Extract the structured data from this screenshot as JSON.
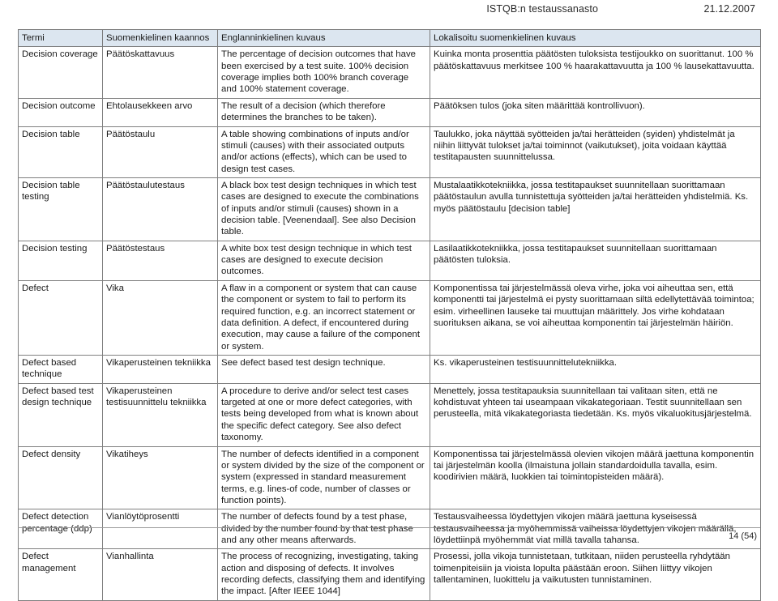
{
  "header": {
    "title": "ISTQB:n testaussanasto",
    "date": "21.12.2007"
  },
  "table": {
    "columns": [
      "Termi",
      "Suomenkielinen kaannos",
      "Englanninkielinen kuvaus",
      "Lokalisoitu suomenkielinen kuvaus"
    ],
    "rows": [
      {
        "term": "Decision coverage",
        "finnish": "Päätöskattavuus",
        "english": "The percentage of decision outcomes that have been exercised by a test suite. 100% decision coverage implies both 100% branch coverage and 100% statement coverage.",
        "localized": "Kuinka monta prosenttia päätösten tuloksista testijoukko on suorittanut. 100 % päätöskattavuus merkitsee 100 % haarakattavuutta ja 100 % lausekattavuutta."
      },
      {
        "term": "Decision outcome",
        "finnish": "Ehtolausekkeen arvo",
        "english": "The result of a decision (which therefore determines the branches to be taken).",
        "localized": "Päätöksen tulos (joka siten määrittää kontrollivuon)."
      },
      {
        "term": "Decision table",
        "finnish": "Päätöstaulu",
        "english": "A table showing combinations of inputs and/or stimuli (causes) with their associated outputs and/or actions (effects), which can be used to design test cases.",
        "localized": "Taulukko, joka näyttää syötteiden ja/tai herätteiden (syiden) yhdistelmät ja niihin liittyvät tulokset ja/tai toiminnot (vaikutukset), joita voidaan käyttää testitapausten suunnittelussa."
      },
      {
        "term": "Decision table testing",
        "finnish": "Päätöstaulutestaus",
        "english": "A black box test design techniques in which test cases are designed to execute the combinations of inputs and/or stimuli (causes) shown in a decision table. [Veenendaal]. See also Decision table.",
        "localized": "Mustalaatikkotekniikka, jossa testitapaukset suunnitellaan suorittamaan päätöstaulun avulla tunnistettuja syötteiden ja/tai herätteiden yhdistelmiä. Ks. myös päätöstaulu [decision table]"
      },
      {
        "term": "Decision testing",
        "finnish": "Päätöstestaus",
        "english": "A white box test design technique in which test cases are designed to execute decision outcomes.",
        "localized": "Lasilaatikkotekniikka, jossa testitapaukset suunnitellaan suorittamaan päätösten tuloksia."
      },
      {
        "term": "Defect",
        "finnish": "Vika",
        "english": "A flaw in a component or system that can cause the component or system to fail to perform its required function, e.g. an incorrect statement or data definition. A defect, if encountered during execution, may cause a failure of the component or system.",
        "localized": "Komponentissa tai järjestelmässä oleva virhe, joka voi aiheuttaa sen, että komponentti tai järjestelmä ei pysty suorittamaan siltä edellytettävää toimintoa; esim. virheellinen lauseke tai muuttujan määrittely. Jos virhe kohdataan suorituksen aikana, se voi aiheuttaa komponentin tai järjestelmän häiriön."
      },
      {
        "term": "Defect based technique",
        "finnish": "Vikaperusteinen tekniikka",
        "english": "See defect based test design technique.",
        "localized": "Ks. vikaperusteinen testisuunnittelutekniikka."
      },
      {
        "term": "Defect based test design technique",
        "finnish": "Vikaperusteinen testisuunnittelu tekniikka",
        "english": "A procedure to derive and/or select test cases targeted at one or more defect categories, with tests being developed from what is known about the specific defect category. See also defect taxonomy.",
        "localized": "Menettely, jossa testitapauksia suunnitellaan tai valitaan siten, että ne kohdistuvat yhteen tai useampaan vikakategoriaan. Testit suunnitellaan sen perusteella, mitä vikakategoriasta tiedetään. Ks. myös vikaluokitusjärjestelmä."
      },
      {
        "term": "Defect density",
        "finnish": "Vikatiheys",
        "english": "The number of defects identified in a component or system divided by the size of the component or system (expressed in standard measurement terms, e.g. lines-of code, number of classes or function points).",
        "localized": "Komponentissa tai järjestelmässä olevien vikojen määrä jaettuna komponentin tai järjestelmän koolla (ilmaistuna jollain standardoidulla tavalla, esim. koodirivien määrä, luokkien tai toimintopisteiden määrä)."
      },
      {
        "term": "Defect detection percentage (ddp)",
        "finnish": "Vianlöytöprosentti",
        "english": "The number of defects found by a test phase, divided by the number found by that test phase and any other means afterwards.",
        "localized": "Testausvaiheessa löydettyjen vikojen määrä jaettuna kyseisessä testausvaiheessa ja myöhemmissä vaiheissa löydettyjen vikojen määrällä, löydettiinpä myöhemmät viat millä tavalla tahansa."
      },
      {
        "term": "Defect management",
        "finnish": "Vianhallinta",
        "english": "The process of recognizing, investigating, taking action and disposing of defects. It involves recording defects, classifying them and identifying the impact. [After IEEE 1044]",
        "localized": "Prosessi, jolla vikoja tunnistetaan, tutkitaan, niiden perusteella ryhdytään toimenpiteisiin ja vioista lopulta päästään eroon. Siihen liittyy vikojen tallentaminen, luokittelu ja vaikutusten tunnistaminen."
      }
    ]
  },
  "footer": {
    "page_number": "14 (54)"
  }
}
